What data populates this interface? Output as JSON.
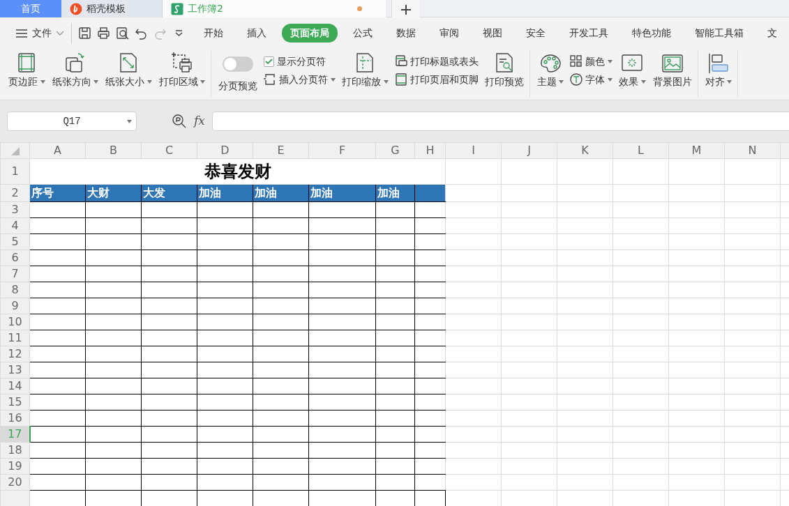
{
  "tabs": [
    {
      "label": "首页",
      "kind": "home",
      "selected": false
    },
    {
      "label": "稻壳模板",
      "kind": "docer",
      "selected": false
    },
    {
      "label": "工作簿2",
      "kind": "sheet",
      "selected": true,
      "modified": true
    }
  ],
  "file_menu": {
    "label": "文件"
  },
  "ribbon_tabs": [
    {
      "label": "开始",
      "selected": false
    },
    {
      "label": "插入",
      "selected": false
    },
    {
      "label": "页面布局",
      "selected": true
    },
    {
      "label": "公式",
      "selected": false
    },
    {
      "label": "数据",
      "selected": false
    },
    {
      "label": "审阅",
      "selected": false
    },
    {
      "label": "视图",
      "selected": false
    },
    {
      "label": "安全",
      "selected": false
    },
    {
      "label": "开发工具",
      "selected": false
    },
    {
      "label": "特色功能",
      "selected": false
    },
    {
      "label": "智能工具箱",
      "selected": false
    },
    {
      "label": "文",
      "selected": false
    }
  ],
  "ribbon_groups": [
    [
      {
        "kind": "large",
        "label": "页边距",
        "dropdown": true
      },
      {
        "kind": "large",
        "label": "纸张方向",
        "dropdown": true
      },
      {
        "kind": "large",
        "label": "纸张大小",
        "dropdown": true
      },
      {
        "kind": "large",
        "label": "打印区域",
        "dropdown": true
      }
    ],
    [
      {
        "kind": "toggle",
        "label": "分页预览",
        "on": false
      },
      {
        "kind": "stack",
        "items": [
          {
            "kind": "check",
            "label": "显示分页符",
            "checked": true
          },
          {
            "kind": "small",
            "label": "插入分页符",
            "dropdown": true
          }
        ]
      },
      {
        "kind": "large",
        "label": "打印缩放",
        "dropdown": true
      },
      {
        "kind": "stack",
        "items": [
          {
            "kind": "small",
            "label": "打印标题或表头",
            "dropdown": false
          },
          {
            "kind": "small",
            "label": "打印页眉和页脚",
            "dropdown": false
          }
        ]
      },
      {
        "kind": "large",
        "label": "打印预览",
        "dropdown": false
      }
    ],
    [
      {
        "kind": "large",
        "label": "主题",
        "dropdown": true
      },
      {
        "kind": "stack",
        "items": [
          {
            "kind": "small",
            "label": "颜色",
            "dropdown": true
          },
          {
            "kind": "small",
            "label": "字体",
            "dropdown": true
          }
        ]
      },
      {
        "kind": "large",
        "label": "效果",
        "dropdown": true
      },
      {
        "kind": "large",
        "label": "背景图片",
        "dropdown": false
      }
    ],
    [
      {
        "kind": "large",
        "label": "对齐",
        "dropdown": true
      }
    ]
  ],
  "name_box": {
    "value": "Q17"
  },
  "formula_bar": {
    "fx_label": "fx"
  },
  "sheet": {
    "columns": [
      "A",
      "B",
      "C",
      "D",
      "E",
      "F",
      "G",
      "H",
      "I",
      "J",
      "K",
      "L",
      "M",
      "N"
    ],
    "title": "恭喜发财",
    "header_row": [
      "序号",
      "大财",
      "大发",
      "加油",
      "加油",
      "加油",
      "加油"
    ],
    "rows": [
      {
        "label": "1",
        "selected": false
      },
      {
        "label": "2",
        "selected": false
      },
      {
        "label": "3",
        "selected": false
      },
      {
        "label": "4",
        "selected": false
      },
      {
        "label": "5",
        "selected": false
      },
      {
        "label": "6",
        "selected": false
      },
      {
        "label": "7",
        "selected": false
      },
      {
        "label": "8",
        "selected": false
      },
      {
        "label": "9",
        "selected": false
      },
      {
        "label": "10",
        "selected": false
      },
      {
        "label": "11",
        "selected": false
      },
      {
        "label": "12",
        "selected": false
      },
      {
        "label": "13",
        "selected": false
      },
      {
        "label": "14",
        "selected": false
      },
      {
        "label": "15",
        "selected": false
      },
      {
        "label": "16",
        "selected": false
      },
      {
        "label": "17",
        "selected": true
      },
      {
        "label": "18",
        "selected": false
      },
      {
        "label": "19",
        "selected": false
      },
      {
        "label": "20",
        "selected": false
      }
    ]
  }
}
